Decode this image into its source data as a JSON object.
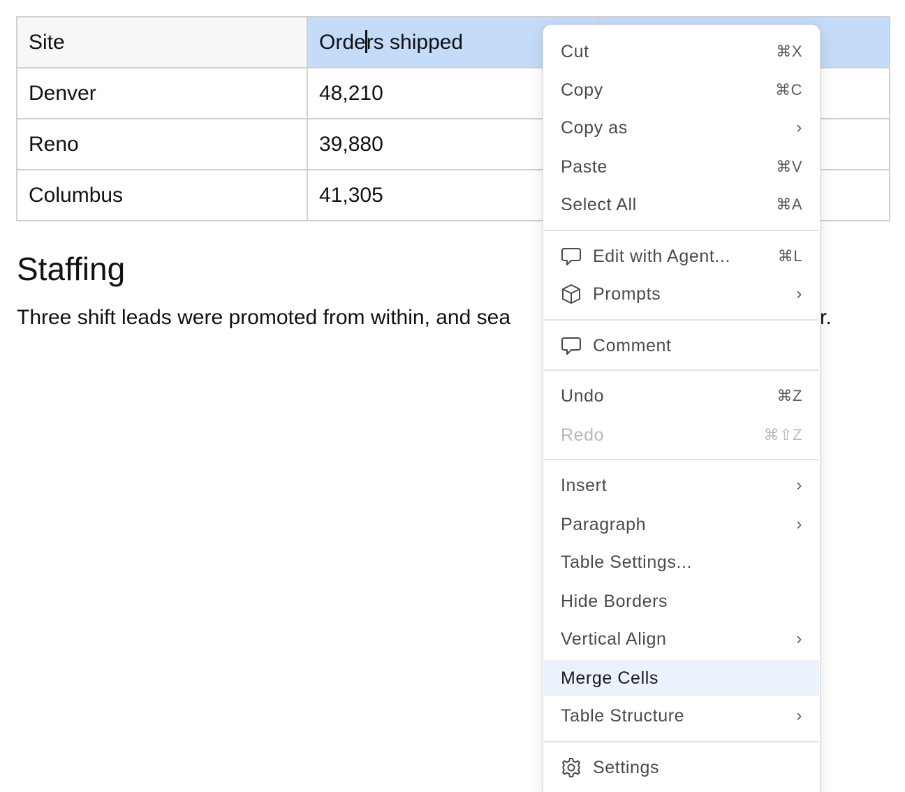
{
  "table": {
    "header": [
      "Site",
      "Orders shipped",
      ""
    ],
    "rows": [
      [
        "Denver",
        "48,210",
        ""
      ],
      [
        "Reno",
        "39,880",
        ""
      ],
      [
        "Columbus",
        "41,305",
        ""
      ]
    ]
  },
  "content": {
    "heading": "Staffing",
    "paragraph_visible": "Three shift leads were promoted from within, and sea",
    "paragraph_tail": "r."
  },
  "colors": {
    "selected_header": "#c4dbf9",
    "menu_active": "#ecf2fb",
    "disabled_text": "#b8b8b8"
  },
  "menu": {
    "items": [
      {
        "label": "Cut",
        "shortcut": "⌘X"
      },
      {
        "label": "Copy",
        "shortcut": "⌘C"
      },
      {
        "label": "Copy as",
        "submenu": "›"
      },
      {
        "label": "Paste",
        "shortcut": "⌘V"
      },
      {
        "label": "Select All",
        "shortcut": "⌘A"
      },
      {
        "label": "Edit with Agent...",
        "shortcut": "⌘L",
        "icon": "comment-icon"
      },
      {
        "label": "Prompts",
        "submenu": "›",
        "icon": "cube-icon"
      },
      {
        "label": "Comment",
        "icon": "comment-icon"
      },
      {
        "label": "Undo",
        "shortcut": "⌘Z"
      },
      {
        "label": "Redo",
        "shortcut": "⌘⇧Z",
        "disabled": true
      },
      {
        "label": "Insert",
        "submenu": "›"
      },
      {
        "label": "Paragraph",
        "submenu": "›"
      },
      {
        "label": "Table Settings..."
      },
      {
        "label": "Hide Borders"
      },
      {
        "label": "Vertical Align",
        "submenu": "›"
      },
      {
        "label": "Merge Cells",
        "highlighted": true
      },
      {
        "label": "Table Structure",
        "submenu": "›"
      },
      {
        "label": "Settings",
        "icon": "gear-icon"
      }
    ]
  }
}
